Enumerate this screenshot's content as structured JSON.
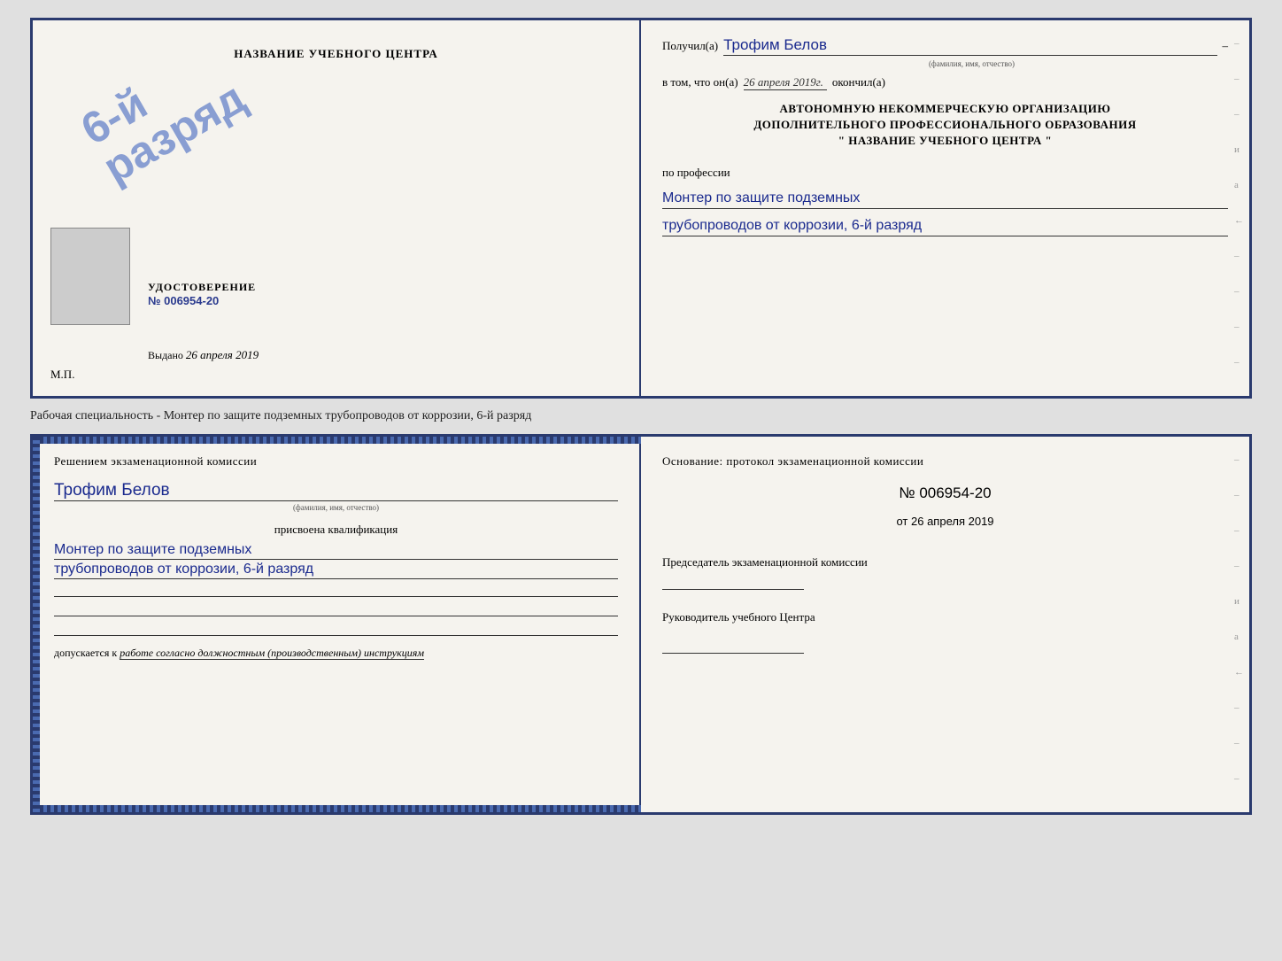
{
  "top": {
    "left": {
      "title": "НАЗВАНИЕ УЧЕБНОГО ЦЕНТРА",
      "stamp_line1": "6-й",
      "stamp_line2": "разряд",
      "udostoverenie_label": "УДОСТОВЕРЕНИЕ",
      "udostoverenie_num": "№ 006954-20",
      "vydano_label": "Выдано",
      "vydano_date": "26 апреля 2019",
      "mp": "М.П."
    },
    "right": {
      "poluchil_label": "Получил(а)",
      "poluchil_name": "Трофим Белов",
      "poluchil_subtitle": "(фамилия, имя, отчество)",
      "vtom_prefix": "в том, что он(а)",
      "vtom_date": "26 апреля 2019г.",
      "vtom_suffix": "окончил(а)",
      "org_line1": "АВТОНОМНУЮ НЕКОММЕРЧЕСКУЮ ОРГАНИЗАЦИЮ",
      "org_line2": "ДОПОЛНИТЕЛЬНОГО ПРОФЕССИОНАЛЬНОГО ОБРАЗОВАНИЯ",
      "org_quote": "\"",
      "org_name": "НАЗВАНИЕ УЧЕБНОГО ЦЕНТРА",
      "po_professii": "по профессии",
      "prof_line1": "Монтер по защите подземных",
      "prof_line2": "трубопроводов от коррозии, 6-й разряд",
      "dashes": [
        "-",
        "-",
        "-",
        "и",
        "а",
        "←",
        "-",
        "-",
        "-",
        "-",
        "-"
      ]
    }
  },
  "separator": "Рабочая специальность - Монтер по защите подземных трубопроводов от коррозии, 6-й разряд",
  "bottom": {
    "left": {
      "resheniem": "Решением экзаменационной комиссии",
      "name": "Трофим Белов",
      "name_subtitle": "(фамилия, имя, отчество)",
      "prisvoyena": "присвоена квалификация",
      "prof1": "Монтер по защите подземных",
      "prof2": "трубопроводов от коррозии, 6-й разряд",
      "dopuskaetsya_prefix": "допускается к",
      "dopuskaetsya_text": "работе согласно должностным (производственным) инструкциям"
    },
    "right": {
      "osnovanie": "Основание: протокол экзаменационной комиссии",
      "num": "№ 006954-20",
      "ot_prefix": "от",
      "ot_date": "26 апреля 2019",
      "predsedatel_label": "Председатель экзаменационной комиссии",
      "rukovoditel_label": "Руководитель учебного Центра",
      "dashes": [
        "-",
        "-",
        "-",
        "-",
        "и",
        "а",
        "←",
        "-",
        "-",
        "-",
        "-",
        "-"
      ]
    }
  }
}
